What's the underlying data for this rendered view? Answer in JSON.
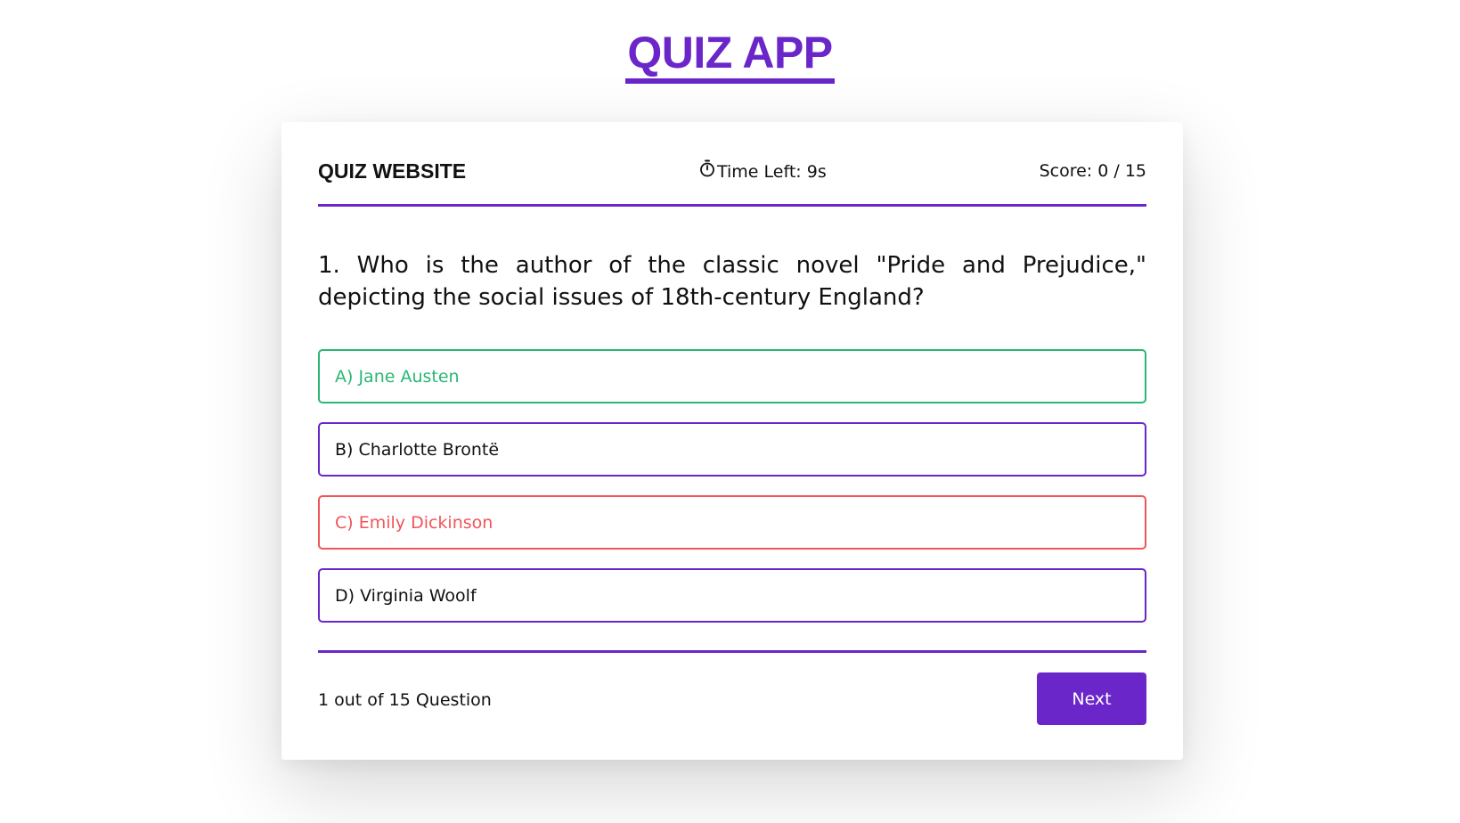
{
  "app": {
    "title": "QUIZ APP"
  },
  "header": {
    "brand": "QUIZ WEBSITE",
    "timer_icon": "stopwatch-icon",
    "timer_text": "Time Left: 9s",
    "score_text": "Score: 0 / 15"
  },
  "question": {
    "text": "1. Who is the author of the classic novel \"Pride and Prejudice,\" depicting the social issues of 18th-century England?"
  },
  "options": [
    {
      "label": "A) Jane Austen",
      "state": "correct"
    },
    {
      "label": "B) Charlotte Brontë",
      "state": "default"
    },
    {
      "label": "C) Emily Dickinson",
      "state": "wrong"
    },
    {
      "label": "D) Virginia Woolf",
      "state": "default"
    }
  ],
  "footer": {
    "progress_text": "1 out of 15 Question",
    "next_label": "Next"
  },
  "colors": {
    "accent": "#6a26c9",
    "correct": "#2bb673",
    "wrong": "#f0555a",
    "text": "#111111",
    "background": "#ffffff"
  }
}
